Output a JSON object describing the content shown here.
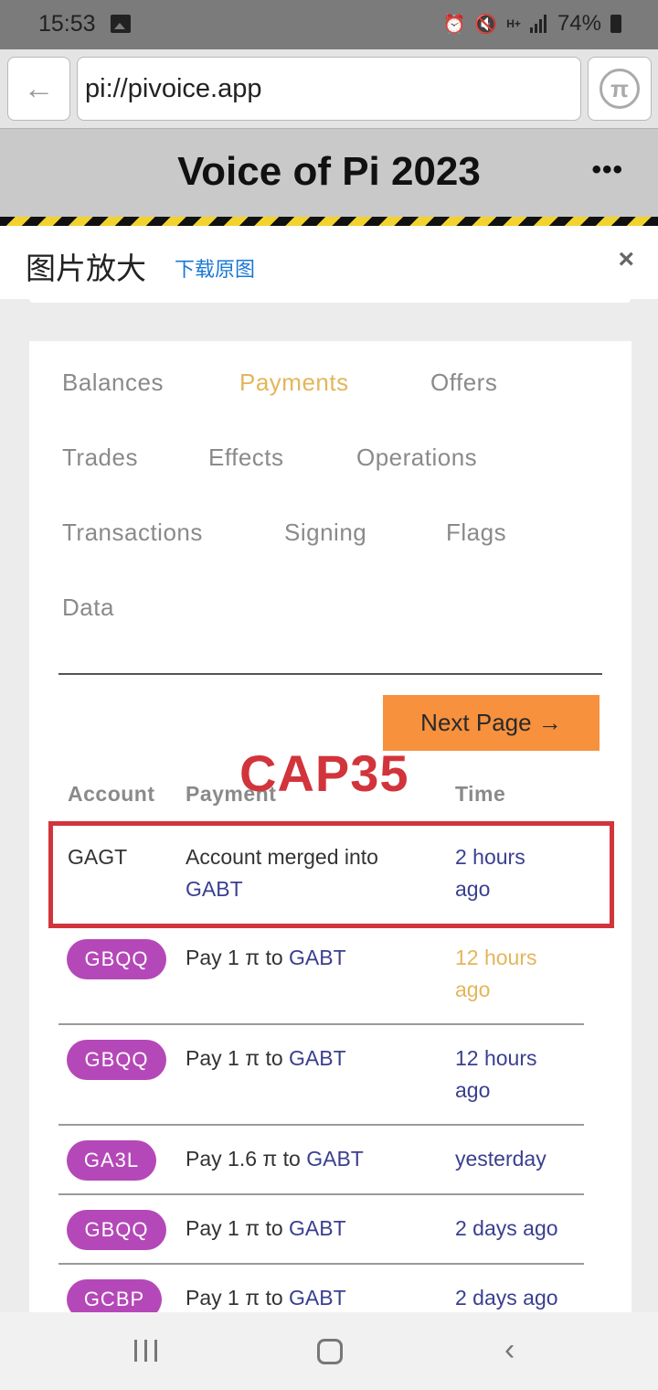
{
  "status_bar": {
    "time": "15:53",
    "network": "H+",
    "battery": "74%"
  },
  "address_bar": {
    "url": "pi://pivoice.app"
  },
  "app_header": {
    "title": "Voice of Pi 2023",
    "menu": "•••"
  },
  "modal": {
    "title": "图片放大",
    "download_link": "下载原图",
    "close": "×"
  },
  "tabs": [
    {
      "label": "Balances",
      "active": false
    },
    {
      "label": "Payments",
      "active": true
    },
    {
      "label": "Offers",
      "active": false
    },
    {
      "label": "Trades",
      "active": false
    },
    {
      "label": "Effects",
      "active": false
    },
    {
      "label": "Operations",
      "active": false
    },
    {
      "label": "Transactions",
      "active": false
    },
    {
      "label": "Signing",
      "active": false
    },
    {
      "label": "Flags",
      "active": false
    },
    {
      "label": "Data",
      "active": false
    }
  ],
  "next_page": "Next Page →",
  "watermark": "CAP35",
  "table": {
    "headers": {
      "account": "Account",
      "payment": "Payment",
      "time": "Time"
    },
    "rows": [
      {
        "account": "GAGT",
        "payment_text": "Account merged into",
        "payment_link": "GABT",
        "time_line1": "2 hours",
        "time_line2": "ago"
      },
      {
        "account": "GBQQ",
        "payment_text": "Pay 1 π to",
        "payment_link": "GABT",
        "time_line1": "12 hours",
        "time_line2": "ago"
      },
      {
        "account": "GBQQ",
        "payment_text": "Pay 1 π to",
        "payment_link": "GABT",
        "time_line1": "12 hours",
        "time_line2": "ago"
      },
      {
        "account": "GA3L",
        "payment_text": "Pay 1.6 π to",
        "payment_link": "GABT",
        "time_line1": "yesterday",
        "time_line2": ""
      },
      {
        "account": "GBQQ",
        "payment_text": "Pay 1 π to",
        "payment_link": "GABT",
        "time_line1": "2 days ago",
        "time_line2": ""
      },
      {
        "account": "GCBP",
        "payment_text": "Pay 1 π to",
        "payment_link": "GABT",
        "time_line1": "2 days ago",
        "time_line2": ""
      }
    ]
  },
  "colors": {
    "active_tab": "#e4b55a",
    "badge": "#b548b8",
    "link": "#3a3f8f",
    "next_button": "#f7913e",
    "highlight": "#d2343c"
  }
}
